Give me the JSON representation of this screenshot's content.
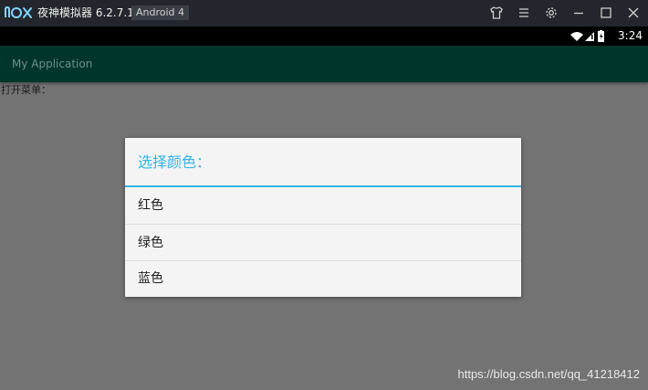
{
  "emulator": {
    "title": "夜神模拟器 6.2.7.1",
    "android_badge": "Android 4",
    "logo_text": "nox",
    "controls": [
      "shirt-icon",
      "menu-icon",
      "gear-icon",
      "minimize-icon",
      "maximize-icon",
      "close-icon"
    ]
  },
  "status_bar": {
    "time": "3:24",
    "icons": [
      "wifi-icon",
      "signal-icon",
      "battery-icon"
    ]
  },
  "app_bar": {
    "title": "My Application"
  },
  "content": {
    "label": "打开菜单："
  },
  "dialog": {
    "title": "选择颜色：",
    "items": [
      {
        "label": "红色"
      },
      {
        "label": "绿色"
      },
      {
        "label": "蓝色"
      }
    ],
    "accent_color": "#33b5e5"
  },
  "watermark": "https://blog.csdn.net/qq_41218412",
  "colors": {
    "emulator_bar": "#23272d",
    "app_bar": "#00352c",
    "scrim_background": "#737373",
    "dialog_background": "#f4f4f4"
  }
}
